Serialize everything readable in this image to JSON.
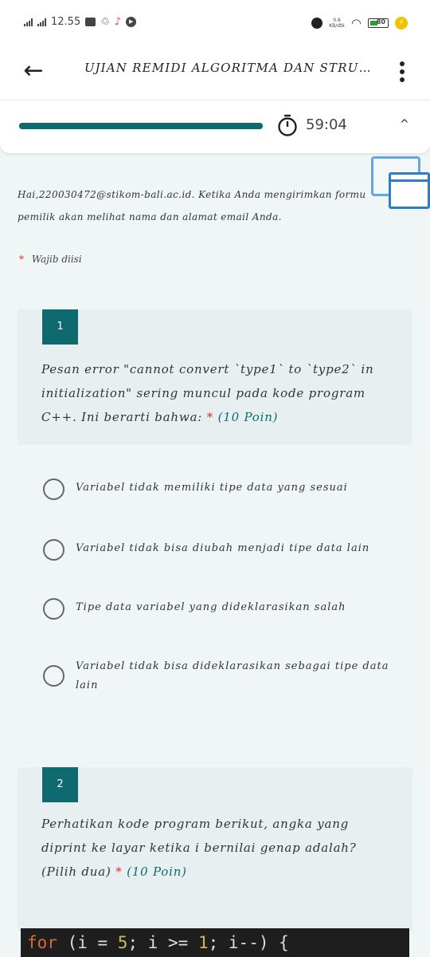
{
  "status_bar": {
    "time": "12.55",
    "net_speed_value": "0.6",
    "net_speed_unit": "KB/dtk",
    "battery": "80",
    "bolt": "⚡"
  },
  "app_bar": {
    "title": "UJIAN REMIDI ALGORITMA DAN STRUK..."
  },
  "timer": {
    "progress": 1.0,
    "remaining": "59:04",
    "collapse_glyph": "^"
  },
  "notice": {
    "line1": "Hai,220030472@stikom-bali.ac.id. Ketika Anda mengirimkan formu",
    "line2": "pemilik akan melihat nama dan alamat email Anda."
  },
  "required_note": {
    "star": "*",
    "text": "Wajib diisi"
  },
  "questions": [
    {
      "number": "1",
      "text_lines": [
        "Pesan error \"cannot convert `type1` to `type2` in",
        "initialization\" sering muncul pada kode program",
        "C++. Ini berarti bahwa:"
      ],
      "star": "*",
      "points": "(10 Poin)",
      "options": [
        {
          "lines": [
            "Variabel tidak memiliki tipe data yang sesuai"
          ]
        },
        {
          "lines": [
            "Variabel tidak bisa diubah menjadi tipe data lain"
          ]
        },
        {
          "lines": [
            "Tipe data variabel yang dideklarasikan salah"
          ]
        },
        {
          "lines": [
            "Variabel tidak bisa dideklarasikan sebagai tipe data",
            "lain"
          ]
        }
      ]
    },
    {
      "number": "2",
      "text_lines": [
        "Perhatikan kode program berikut, angka yang",
        "diprint ke layar ketika i bernilai genap adalah?",
        "(Pilih dua)"
      ],
      "star": "*",
      "points": "(10 Poin)"
    }
  ],
  "code": {
    "kw": "for",
    "p1": " (i = ",
    "n1": "5",
    "p2": "; i >= ",
    "n2": "1",
    "p3": "; i--) {"
  },
  "colors": {
    "accent": "#0e6a6f",
    "required": "#d93025",
    "card_bg": "#e7eff1",
    "page_bg": "#f0f5f6"
  }
}
